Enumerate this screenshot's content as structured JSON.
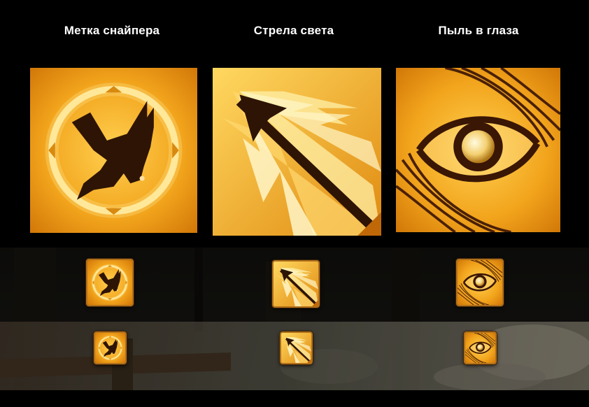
{
  "abilities": [
    {
      "title": "Метка снайпера",
      "icon": "hawk-crosshair-icon"
    },
    {
      "title": "Стрела света",
      "icon": "light-arrow-icon"
    },
    {
      "title": "Пыль в глаза",
      "icon": "eye-icon"
    }
  ],
  "colors": {
    "background": "#000000",
    "icon_gold": "#f0a820",
    "icon_dark": "#3a1a06",
    "icon_border": "#b0701a"
  }
}
